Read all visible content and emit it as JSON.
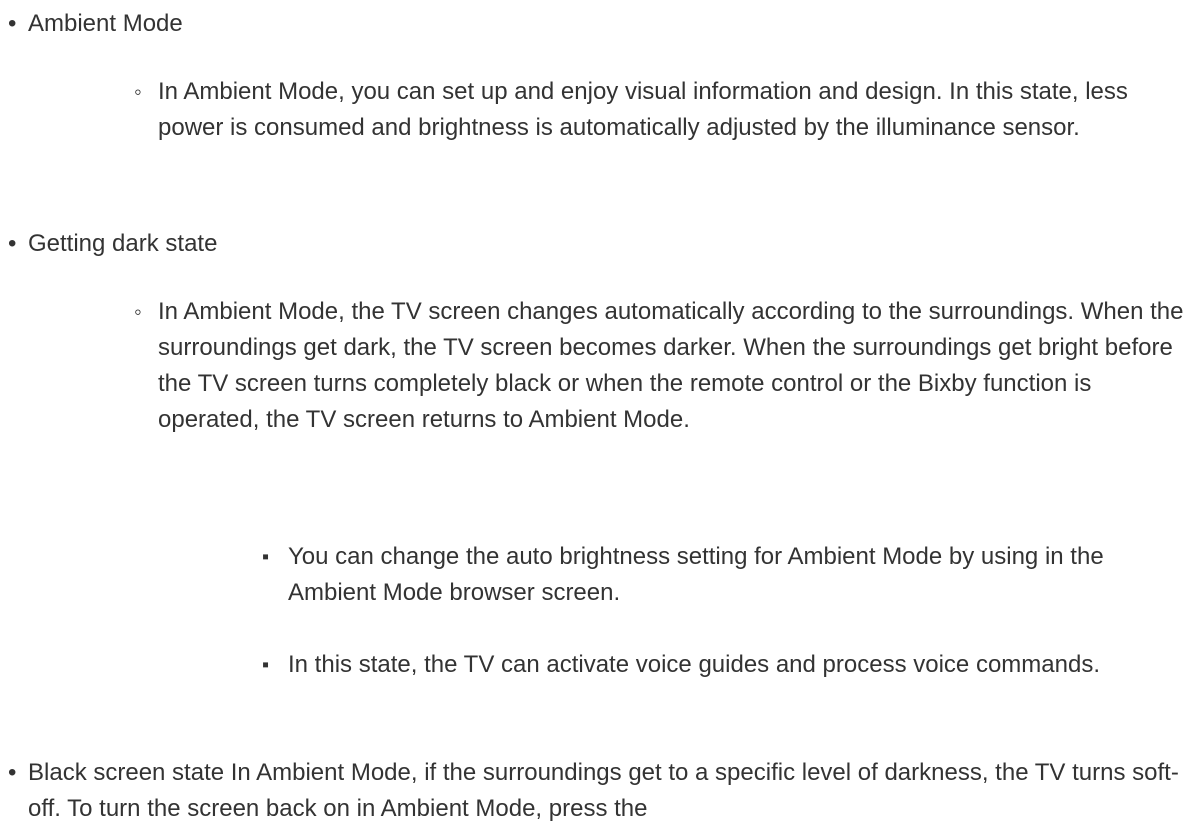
{
  "bullets": {
    "level1": "•",
    "level2": "◦",
    "level3": "▪"
  },
  "items": [
    {
      "level": 1,
      "text": "Ambient Mode"
    },
    {
      "level": 2,
      "text": "In Ambient Mode, you can set up and enjoy visual information and design. In this state, less power is consumed and brightness is automatically adjusted by the illuminance sensor."
    },
    {
      "level": 1,
      "text": "Getting dark state"
    },
    {
      "level": 2,
      "text": "In Ambient Mode, the TV screen changes automatically according to the surroundings. When the surroundings get dark, the TV screen becomes darker. When the surroundings get bright before the TV screen turns completely black or when the remote control or the Bixby function is operated, the TV screen returns to Ambient Mode."
    },
    {
      "level": 3,
      "text": "You can change the auto brightness setting for Ambient Mode by using in the Ambient Mode browser screen."
    },
    {
      "level": 3,
      "text": "In this state, the TV can activate voice guides and process voice commands."
    },
    {
      "level": 1,
      "text": "Black screen state In Ambient Mode, if the surroundings get to a specific level of darkness, the TV turns soft-off. To turn the screen back on in Ambient Mode, press the"
    }
  ]
}
